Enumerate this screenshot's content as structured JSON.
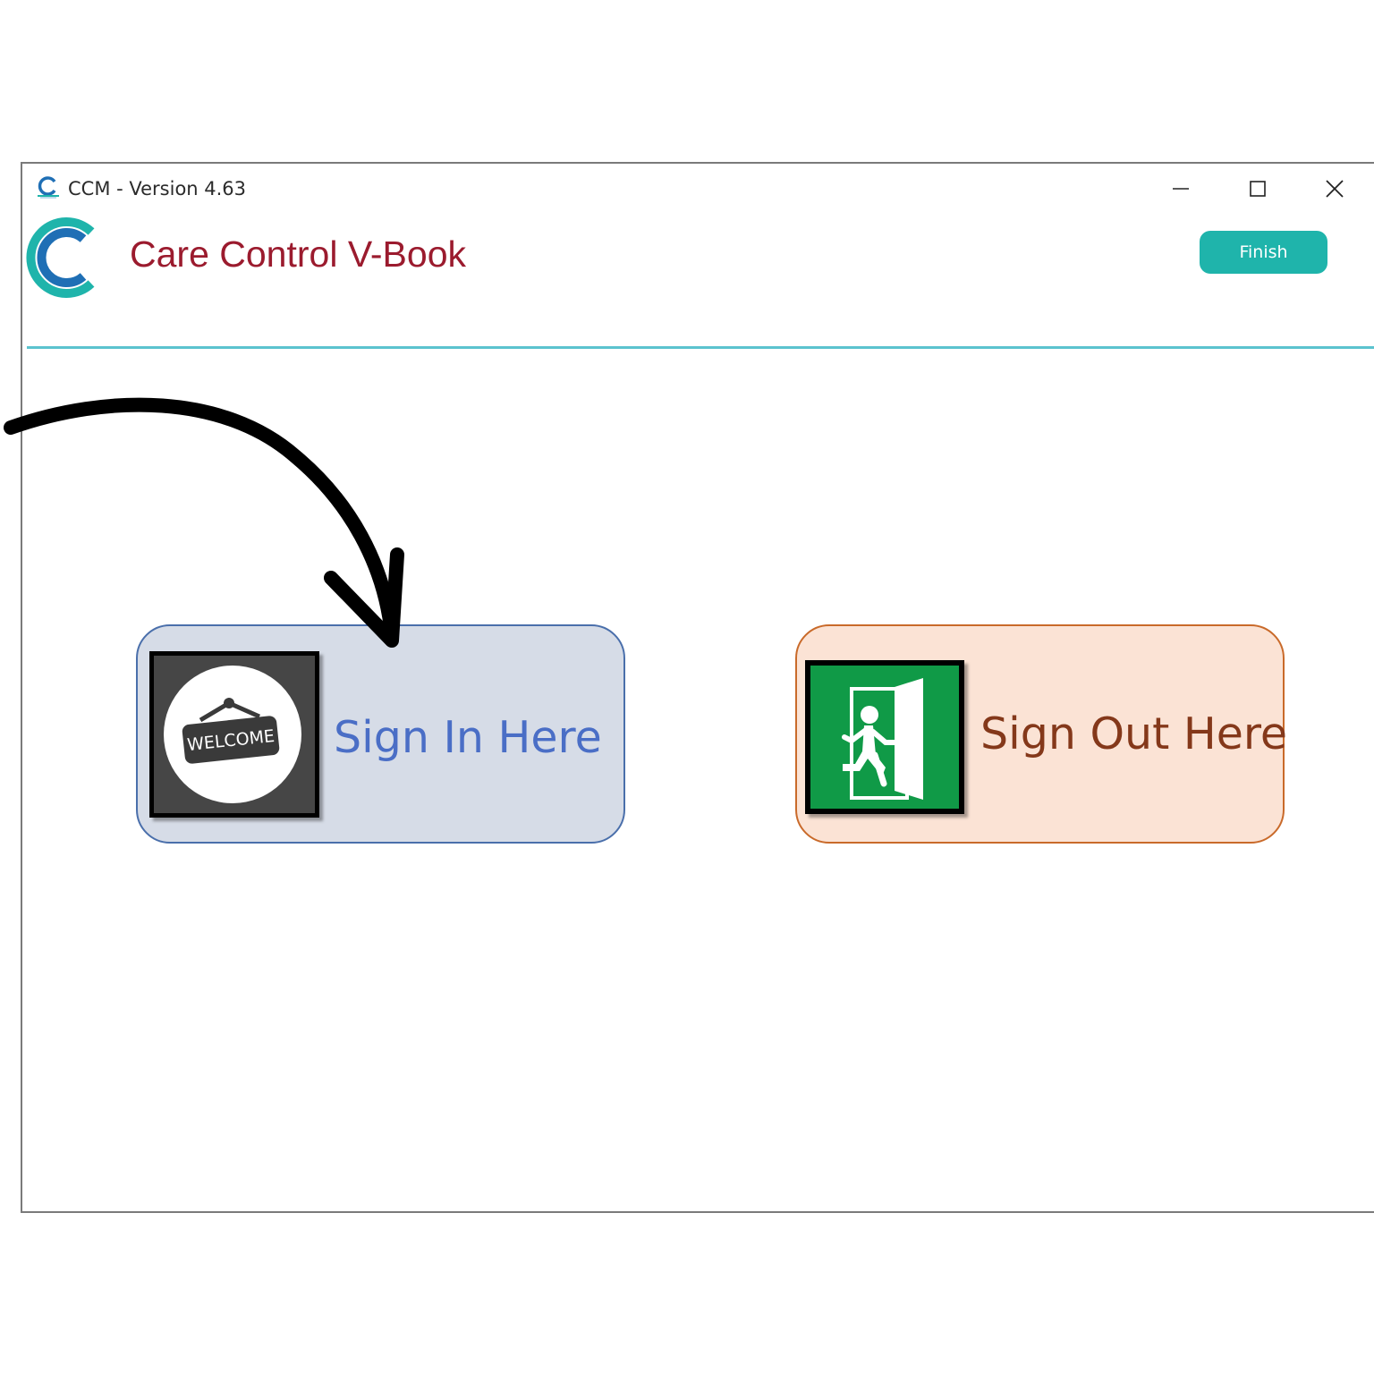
{
  "window": {
    "title": "CCM - Version 4.63",
    "app_name": "Care Control V-Book",
    "finish_label": "Finish",
    "controls": [
      "minimize-icon",
      "maximize-icon",
      "close-icon"
    ]
  },
  "buttons": {
    "sign_in": {
      "label": "Sign In Here",
      "icon": "welcome-sign-icon",
      "icon_text": "WELCOME"
    },
    "sign_out": {
      "label": "Sign Out Here",
      "icon": "exit-door-icon"
    }
  },
  "annotation": {
    "icon": "arrow-pointing-to-sign-in"
  },
  "colors": {
    "brand_title": "#9b1b2e",
    "accent_teal": "#1fb4ab",
    "sign_in_bg": "#d6dce7",
    "sign_in_border": "#4a6fab",
    "sign_in_text": "#4a6ec6",
    "sign_out_bg": "#fbe3d5",
    "sign_out_border": "#c96a2a",
    "sign_out_text": "#84381a",
    "exit_green": "#109a47"
  }
}
